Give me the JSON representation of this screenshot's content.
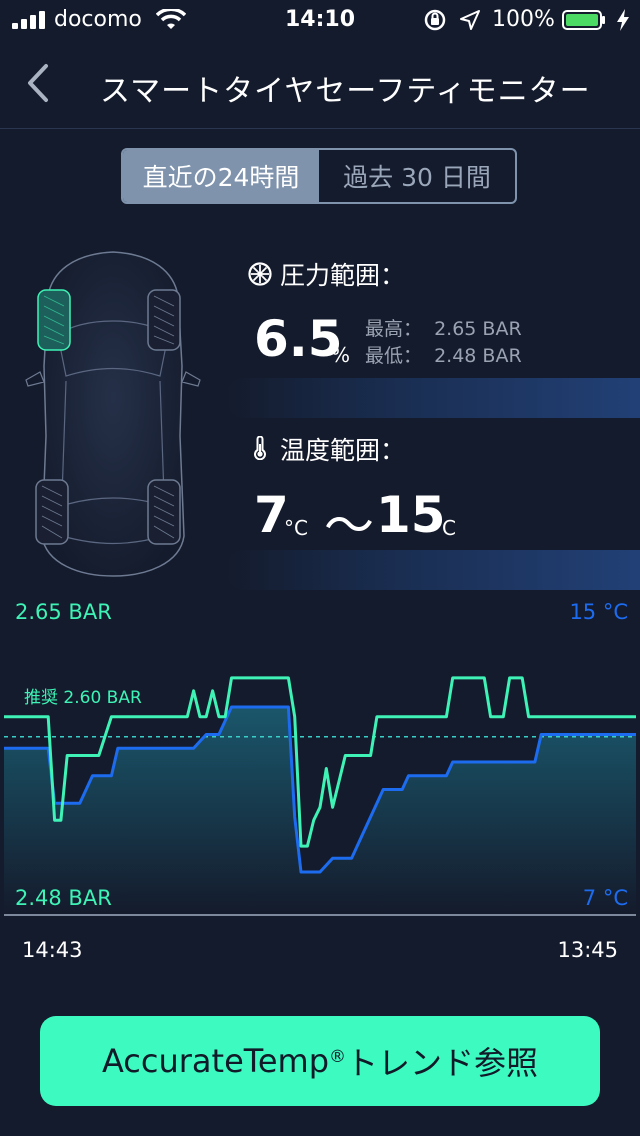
{
  "status_bar": {
    "carrier": "docomo",
    "time": "14:10",
    "battery": "100%"
  },
  "nav": {
    "title": "スマートタイヤセーフティモニター"
  },
  "segment": {
    "active": "直近の24時間",
    "inactive": "過去 30 日間"
  },
  "pressure": {
    "title": "圧力範囲：",
    "value": "6.5",
    "unit": "%",
    "max_label": "最高：",
    "max_value": "2.65 BAR",
    "min_label": "最低：",
    "min_value": "2.48 BAR"
  },
  "temperature": {
    "title": "温度範囲：",
    "low": "7",
    "unit": "°C",
    "sep": "～",
    "high": "15"
  },
  "chart_data": {
    "type": "line",
    "y_left_top": "2.65 BAR",
    "y_left_bottom": "2.48 BAR",
    "y_right_top": "15 °C",
    "y_right_bottom": "7 °C",
    "recommended_label": "推奨 2.60 BAR",
    "recommended_value": 2.6,
    "x_start": "14:43",
    "x_end": "13:45",
    "ylim_pressure": [
      2.48,
      2.65
    ],
    "ylim_temp": [
      7,
      15
    ],
    "colors": {
      "pressure": "#3ef3b5",
      "temperature": "#1d6cf0",
      "recommended": "#3ad0c8"
    },
    "series": [
      {
        "name": "pressure",
        "points": [
          [
            0,
            2.6
          ],
          [
            0.07,
            2.6
          ],
          [
            0.08,
            2.52
          ],
          [
            0.09,
            2.52
          ],
          [
            0.1,
            2.57
          ],
          [
            0.15,
            2.57
          ],
          [
            0.17,
            2.6
          ],
          [
            0.18,
            2.6
          ],
          [
            0.29,
            2.6
          ],
          [
            0.3,
            2.62
          ],
          [
            0.31,
            2.6
          ],
          [
            0.32,
            2.6
          ],
          [
            0.33,
            2.62
          ],
          [
            0.34,
            2.6
          ],
          [
            0.35,
            2.6
          ],
          [
            0.36,
            2.63
          ],
          [
            0.45,
            2.63
          ],
          [
            0.46,
            2.6
          ],
          [
            0.47,
            2.5
          ],
          [
            0.48,
            2.5
          ],
          [
            0.49,
            2.52
          ],
          [
            0.5,
            2.53
          ],
          [
            0.51,
            2.56
          ],
          [
            0.52,
            2.53
          ],
          [
            0.53,
            2.55
          ],
          [
            0.54,
            2.57
          ],
          [
            0.58,
            2.57
          ],
          [
            0.59,
            2.6
          ],
          [
            0.7,
            2.6
          ],
          [
            0.71,
            2.63
          ],
          [
            0.76,
            2.63
          ],
          [
            0.77,
            2.6
          ],
          [
            0.79,
            2.6
          ],
          [
            0.8,
            2.63
          ],
          [
            0.82,
            2.63
          ],
          [
            0.83,
            2.6
          ],
          [
            1.0,
            2.6
          ]
        ]
      },
      {
        "name": "temperature",
        "points": [
          [
            0,
            11.5
          ],
          [
            0.07,
            11.5
          ],
          [
            0.08,
            9.5
          ],
          [
            0.12,
            9.5
          ],
          [
            0.14,
            10.5
          ],
          [
            0.17,
            10.5
          ],
          [
            0.18,
            11.5
          ],
          [
            0.3,
            11.5
          ],
          [
            0.32,
            12.0
          ],
          [
            0.34,
            12.0
          ],
          [
            0.35,
            12.5
          ],
          [
            0.36,
            13.0
          ],
          [
            0.45,
            13.0
          ],
          [
            0.46,
            9.0
          ],
          [
            0.47,
            7.0
          ],
          [
            0.5,
            7.0
          ],
          [
            0.52,
            7.5
          ],
          [
            0.55,
            7.5
          ],
          [
            0.57,
            8.5
          ],
          [
            0.59,
            9.5
          ],
          [
            0.6,
            10.0
          ],
          [
            0.63,
            10.0
          ],
          [
            0.64,
            10.5
          ],
          [
            0.7,
            10.5
          ],
          [
            0.71,
            11.0
          ],
          [
            0.84,
            11.0
          ],
          [
            0.85,
            12.0
          ],
          [
            1.0,
            12.0
          ]
        ]
      }
    ]
  },
  "cta": {
    "label": "AccurateTemp",
    "reg": "®",
    "label2": "トレンド参照"
  }
}
